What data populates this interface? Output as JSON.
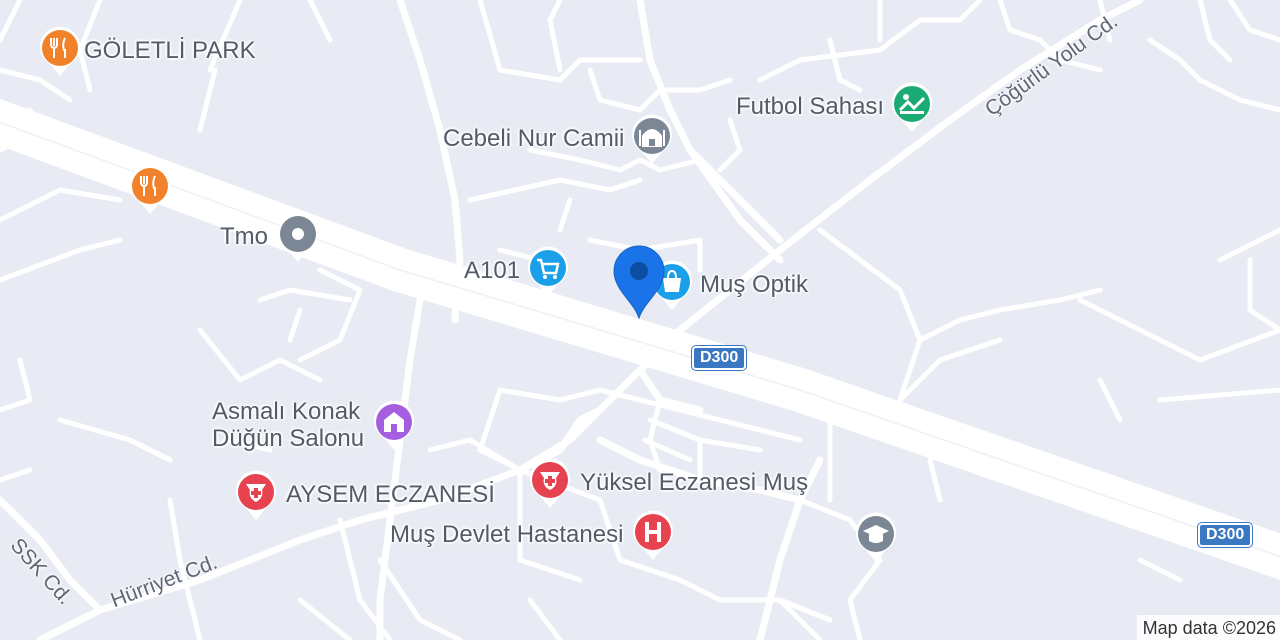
{
  "map": {
    "background_color": "#e8ebf3",
    "road_color": "#ffffff",
    "attribution": "Map data ©2026"
  },
  "road_labels": {
    "cogurlu": "Çöğürlü Yolu Cd.",
    "hurriyet": "Hürriyet Cd.",
    "ssk": "SSK Cd.",
    "d300_center": "D300",
    "d300_right": "D300"
  },
  "pois": {
    "goletli_park": {
      "label": "GÖLETLİ PARK",
      "icon": "restaurant-icon",
      "color": "#f1822b"
    },
    "restaurant_2": {
      "label": "",
      "icon": "restaurant-icon",
      "color": "#f1822b"
    },
    "cebeli_nur_camii": {
      "label": "Cebeli Nur Camii",
      "icon": "mosque-icon",
      "color": "#7b8794"
    },
    "futbol_sahasi": {
      "label": "Futbol Sahası",
      "icon": "sports-icon",
      "color": "#1aab74"
    },
    "tmo": {
      "label": "Tmo",
      "icon": "place-icon",
      "color": "#7b8794"
    },
    "a101": {
      "label": "A101",
      "icon": "shopping-cart-icon",
      "color": "#1a9fe8"
    },
    "mus_optik": {
      "label": "Muş Optik",
      "icon": "shopping-bag-icon",
      "color": "#1a9fe8"
    },
    "asmali_konak": {
      "label_line1": "Asmalı Konak",
      "label_line2": "Düğün Salonu",
      "icon": "venue-icon",
      "color": "#a65ee0"
    },
    "aysem": {
      "label": "AYSEM ECZANESİ",
      "icon": "pharmacy-icon",
      "color": "#e7424f"
    },
    "yuksel": {
      "label": "Yüksel Eczanesi Muş",
      "icon": "pharmacy-icon",
      "color": "#e7424f"
    },
    "devlet_hastanesi": {
      "label": "Muş Devlet Hastanesi",
      "icon": "hospital-icon",
      "color": "#e7424f"
    },
    "school": {
      "label": "",
      "icon": "school-icon",
      "color": "#7b8794"
    }
  },
  "marker": {
    "color": "#1a73e8",
    "icon": "location-marker-icon"
  }
}
